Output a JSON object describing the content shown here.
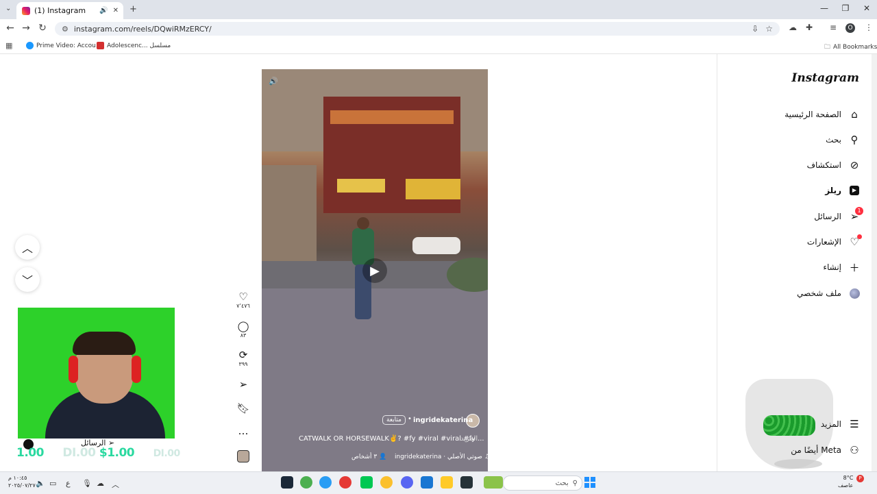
{
  "browser": {
    "tab_title": "(1) Instagram",
    "tab_audio_icon": "🔊",
    "tab_close": "✕",
    "new_tab": "+",
    "url": "instagram.com/reels/DQwiRMzERCY/",
    "bookmarks": [
      {
        "label": "Prime Video: Accou...",
        "icon": "prime-video-icon",
        "color": "#1a98ff"
      },
      {
        "label": "Adolescenc... مسلسل",
        "icon": "site-icon",
        "color": "#d32f2f"
      }
    ],
    "all_bookmarks": "All Bookmarks",
    "avatar_letter": "O"
  },
  "instagram": {
    "logo": "Instagram",
    "nav": [
      {
        "label": "الصفحة الرئيسية",
        "icon": "home-icon"
      },
      {
        "label": "بحث",
        "icon": "search-icon"
      },
      {
        "label": "استكشاف",
        "icon": "compass-icon"
      },
      {
        "label": "ريلز",
        "icon": "reels-icon",
        "active": true
      },
      {
        "label": "الرسائل",
        "icon": "messenger-icon",
        "badge": "1"
      },
      {
        "label": "الإشعارات",
        "icon": "heart-icon"
      },
      {
        "label": "إنشاء",
        "icon": "plus-icon"
      },
      {
        "label": "ملف شخصي",
        "icon": "profile-avatar"
      }
    ],
    "more": "المزيد",
    "also_from_meta": "أيضًا من Meta"
  },
  "reel": {
    "author": "ingridekaterina",
    "follow": "متابعة",
    "caption": "CATWALK OR HORSEWALK✌️? #fy #viral #viral #fy ...",
    "caption_more": "المزيد",
    "audio": "ingridekaterina · صوتي الأصلي",
    "tagged": "٣ أشخاص",
    "likes": "٧٬٤٧٦",
    "comments": "٨٣",
    "reposts": "٣٩٩"
  },
  "overlay": {
    "webcam_label": "الرسائل",
    "ticker_values": [
      "1.00",
      "DI.00",
      "$1.00",
      "DI.00"
    ]
  },
  "taskbar": {
    "search_placeholder": "بحث",
    "time": "١٠:٤٥ م",
    "date": "٢٠٢٥/٠٧/٢٧",
    "weather_temp": "8°C",
    "weather_desc": "عاصف",
    "notification_count": "P"
  }
}
